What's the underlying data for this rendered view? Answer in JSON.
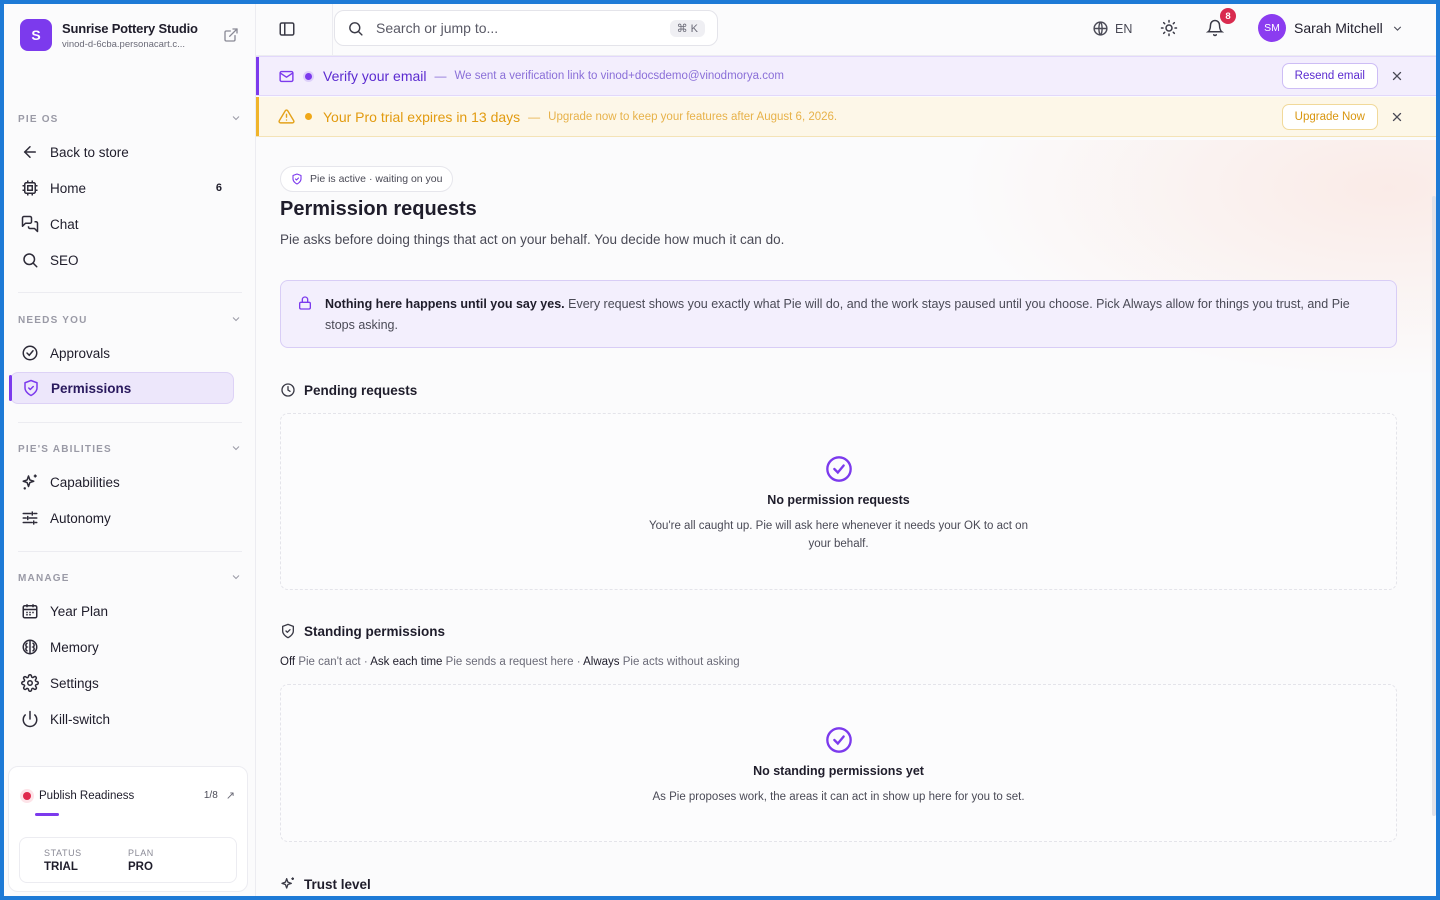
{
  "brand": {
    "initial": "S",
    "name": "Sunrise Pottery Studio",
    "subdomain": "vinod-d-6cba.personacart.c..."
  },
  "sections": {
    "pie_os": "PIE OS",
    "needs_you": "NEEDS YOU",
    "abilities": "PIE'S ABILITIES",
    "manage": "MANAGE"
  },
  "nav": {
    "back": "Back to store",
    "home": "Home",
    "home_count": "6",
    "chat": "Chat",
    "seo": "SEO",
    "approvals": "Approvals",
    "permissions": "Permissions",
    "capabilities": "Capabilities",
    "autonomy": "Autonomy",
    "year_plan": "Year Plan",
    "memory": "Memory",
    "settings": "Settings",
    "kill_switch": "Kill-switch"
  },
  "readiness": {
    "label": "Publish Readiness",
    "count": "1/8",
    "progress_fraction": 0.125,
    "status_key": "STATUS",
    "status_value": "TRIAL",
    "plan_key": "PLAN",
    "plan_value": "PRO"
  },
  "topbar": {
    "search_placeholder": "Search or jump to...",
    "shortcut": "⌘ K",
    "language": "EN",
    "notifications": "8",
    "user_initials": "SM",
    "user_name": "Sarah Mitchell"
  },
  "banners": {
    "verify": {
      "title": "Verify your email",
      "dash": "—",
      "message": "We sent a verification link to vinod+docsdemo@vinodmorya.com",
      "button": "Resend email"
    },
    "trial": {
      "title": "Your Pro trial expires in 13 days",
      "dash": "—",
      "message": "Upgrade now to keep your features after August 6, 2026.",
      "button": "Upgrade Now"
    }
  },
  "page": {
    "status_pill": "Pie is active · waiting on you",
    "title": "Permission requests",
    "subtitle": "Pie asks before doing things that act on your behalf. You decide how much it can do.",
    "info_bold": "Nothing here happens until you say yes.",
    "info_text": " Every request shows you exactly what Pie will do, and the work stays paused until you choose. Pick Always allow for things you trust, and Pie stops asking."
  },
  "pending": {
    "heading": "Pending requests",
    "empty_title": "No permission requests",
    "empty_body": "You're all caught up. Pie will ask here whenever it needs your OK to act on your behalf."
  },
  "standing": {
    "heading": "Standing permissions",
    "legend": [
      {
        "term": "Off",
        "desc": " Pie can't act · "
      },
      {
        "term": "Ask each time",
        "desc": " Pie sends a request here · "
      },
      {
        "term": "Always",
        "desc": " Pie acts without asking"
      }
    ],
    "empty_title": "No standing permissions yet",
    "empty_body": "As Pie proposes work, the areas it can act in show up here for you to set."
  },
  "trust": {
    "heading": "Trust level"
  },
  "colors": {
    "accent": "#7c3aed",
    "warning": "#f0b42a",
    "danger": "#d92b4f"
  }
}
